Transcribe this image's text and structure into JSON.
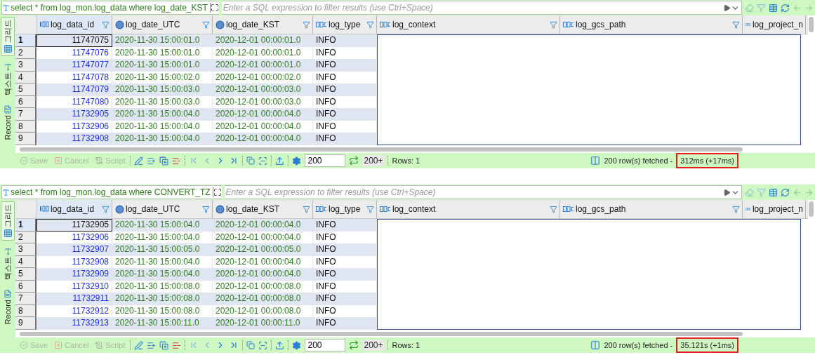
{
  "panels": [
    {
      "query": "select * from log_mon.log_data where log_date_KST",
      "filter_placeholder": "Enter a SQL expression to filter results (use Ctrl+Space)",
      "side_tabs": [
        {
          "label": "그리드",
          "kind": "grid",
          "selected": true
        },
        {
          "label": "텍스트",
          "kind": "text",
          "selected": false
        },
        {
          "label": "Record",
          "kind": "record",
          "selected": false
        }
      ],
      "columns": [
        {
          "label": "log_data_id",
          "kind": "number",
          "filter_icon": true
        },
        {
          "label": "log_date_UTC",
          "kind": "datetime",
          "filter_icon": true
        },
        {
          "label": "log_date_KST",
          "kind": "datetime",
          "filter_icon": true
        },
        {
          "label": "log_type",
          "kind": "text",
          "filter_icon": true
        },
        {
          "label": "log_context",
          "kind": "text",
          "filter_icon": true
        },
        {
          "label": "log_gcs_path",
          "kind": "text",
          "filter_icon": true
        },
        {
          "label": "log_project_n",
          "kind": "text",
          "filter_icon": false
        }
      ],
      "rows": [
        {
          "num": "1",
          "selected": true,
          "cells": [
            "11747075",
            "2020-11-30 15:00:01.0",
            "2020-12-01 00:00:01.0",
            "INFO"
          ]
        },
        {
          "num": "2",
          "selected": false,
          "cells": [
            "11747076",
            "2020-11-30 15:00:01.0",
            "2020-12-01 00:00:01.0",
            "INFO"
          ]
        },
        {
          "num": "3",
          "selected": false,
          "cells": [
            "11747077",
            "2020-11-30 15:00:01.0",
            "2020-12-01 00:00:01.0",
            "INFO"
          ]
        },
        {
          "num": "4",
          "selected": false,
          "cells": [
            "11747078",
            "2020-11-30 15:00:02.0",
            "2020-12-01 00:00:02.0",
            "INFO"
          ]
        },
        {
          "num": "5",
          "selected": false,
          "cells": [
            "11747079",
            "2020-11-30 15:00:03.0",
            "2020-12-01 00:00:03.0",
            "INFO"
          ]
        },
        {
          "num": "6",
          "selected": false,
          "cells": [
            "11747080",
            "2020-11-30 15:00:03.0",
            "2020-12-01 00:00:03.0",
            "INFO"
          ]
        },
        {
          "num": "7",
          "selected": false,
          "cells": [
            "11732905",
            "2020-11-30 15:00:04.0",
            "2020-12-01 00:00:04.0",
            "INFO"
          ]
        },
        {
          "num": "8",
          "selected": false,
          "cells": [
            "11732906",
            "2020-11-30 15:00:04.0",
            "2020-12-01 00:00:04.0",
            "INFO"
          ]
        },
        {
          "num": "9",
          "selected": false,
          "cells": [
            "11732908",
            "2020-11-30 15:00:04.0",
            "2020-12-01 00:00:04.0",
            "INFO"
          ]
        }
      ],
      "actions": [
        {
          "label": "Save",
          "kind": "save",
          "disabled": true
        },
        {
          "label": "Cancel",
          "kind": "cancel",
          "disabled": true
        },
        {
          "label": "Script",
          "kind": "script",
          "disabled": true
        }
      ],
      "fetch_size": "200",
      "fetch_more": "200+",
      "row_count": "Rows: 1",
      "fetched": "200 row(s) fetched -",
      "timing": "312ms (+17ms)",
      "timing_highlighted": true
    },
    {
      "query": "select * from log_mon.log_data where CONVERT_TZ",
      "filter_placeholder": "Enter a SQL expression to filter results (use Ctrl+Space)",
      "side_tabs": [
        {
          "label": "그리드",
          "kind": "grid",
          "selected": true
        },
        {
          "label": "텍스트",
          "kind": "text",
          "selected": false
        },
        {
          "label": "Record",
          "kind": "record",
          "selected": false
        }
      ],
      "columns": [
        {
          "label": "log_data_id",
          "kind": "number",
          "filter_icon": true
        },
        {
          "label": "log_date_UTC",
          "kind": "datetime",
          "filter_icon": true
        },
        {
          "label": "log_date_KST",
          "kind": "datetime",
          "filter_icon": true
        },
        {
          "label": "log_type",
          "kind": "text",
          "filter_icon": true
        },
        {
          "label": "log_context",
          "kind": "text",
          "filter_icon": true
        },
        {
          "label": "log_gcs_path",
          "kind": "text",
          "filter_icon": true
        },
        {
          "label": "log_project_n",
          "kind": "text",
          "filter_icon": false
        }
      ],
      "rows": [
        {
          "num": "1",
          "selected": true,
          "cells": [
            "11732905",
            "2020-11-30 15:00:04.0",
            "2020-12-01 00:00:04.0",
            "INFO"
          ]
        },
        {
          "num": "2",
          "selected": false,
          "cells": [
            "11732906",
            "2020-11-30 15:00:04.0",
            "2020-12-01 00:00:04.0",
            "INFO"
          ]
        },
        {
          "num": "3",
          "selected": false,
          "cells": [
            "11732907",
            "2020-11-30 15:00:05.0",
            "2020-12-01 00:00:05.0",
            "INFO"
          ]
        },
        {
          "num": "4",
          "selected": false,
          "cells": [
            "11732908",
            "2020-11-30 15:00:04.0",
            "2020-12-01 00:00:04.0",
            "INFO"
          ]
        },
        {
          "num": "5",
          "selected": false,
          "cells": [
            "11732909",
            "2020-11-30 15:00:04.0",
            "2020-12-01 00:00:04.0",
            "INFO"
          ]
        },
        {
          "num": "6",
          "selected": false,
          "cells": [
            "11732910",
            "2020-11-30 15:00:08.0",
            "2020-12-01 00:00:08.0",
            "INFO"
          ]
        },
        {
          "num": "7",
          "selected": false,
          "cells": [
            "11732911",
            "2020-11-30 15:00:08.0",
            "2020-12-01 00:00:08.0",
            "INFO"
          ]
        },
        {
          "num": "8",
          "selected": false,
          "cells": [
            "11732912",
            "2020-11-30 15:00:08.0",
            "2020-12-01 00:00:08.0",
            "INFO"
          ]
        },
        {
          "num": "9",
          "selected": false,
          "cells": [
            "11732913",
            "2020-11-30 15:00:11.0",
            "2020-12-01 00:00:11.0",
            "INFO"
          ]
        }
      ],
      "actions": [
        {
          "label": "Save",
          "kind": "save",
          "disabled": true
        },
        {
          "label": "Cancel",
          "kind": "cancel",
          "disabled": true
        },
        {
          "label": "Script",
          "kind": "script",
          "disabled": true
        }
      ],
      "fetch_size": "200",
      "fetch_more": "200+",
      "row_count": "Rows: 1",
      "fetched": "200 row(s) fetched -",
      "timing": "35.121s (+1ms)",
      "timing_highlighted": true
    }
  ]
}
